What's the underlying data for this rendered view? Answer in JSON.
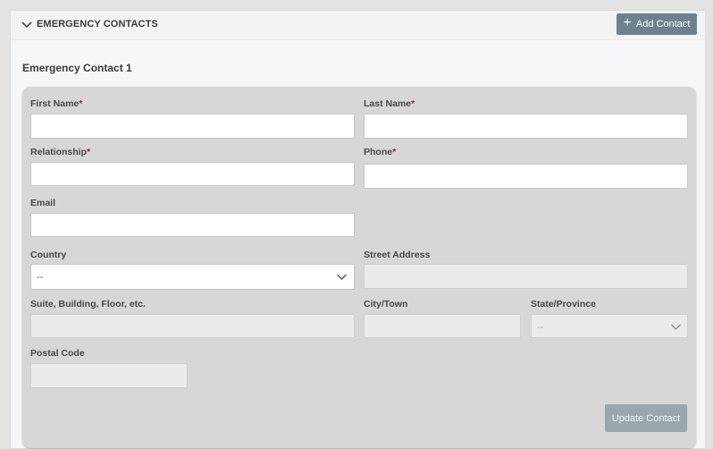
{
  "section": {
    "title": "EMERGENCY CONTACTS",
    "add_button_label": "Add Contact"
  },
  "contact": {
    "title": "Emergency Contact 1",
    "fields": {
      "first_name": {
        "label": "First Name",
        "required_mark": "*",
        "value": ""
      },
      "last_name": {
        "label": "Last Name",
        "required_mark": "*",
        "value": ""
      },
      "relationship": {
        "label": "Relationship",
        "required_mark": "*",
        "value": ""
      },
      "phone": {
        "label": "Phone",
        "required_mark": "*",
        "value": ""
      },
      "email": {
        "label": "Email",
        "value": ""
      },
      "country": {
        "label": "Country",
        "value": "--"
      },
      "street_address": {
        "label": "Street Address",
        "value": ""
      },
      "suite": {
        "label": "Suite, Building, Floor, etc.",
        "value": ""
      },
      "city": {
        "label": "City/Town",
        "value": ""
      },
      "state": {
        "label": "State/Province",
        "value": "--"
      },
      "postal_code": {
        "label": "Postal Code",
        "value": ""
      }
    },
    "update_button_label": "Update Contact"
  },
  "icons": {
    "header_toggle": "chevron-down-icon",
    "add": "plus-icon",
    "select": "chevron-down-icon"
  },
  "colors": {
    "primary_button": "#6c828f",
    "disabled_button": "#9aa8ad",
    "required": "#b3132b"
  }
}
